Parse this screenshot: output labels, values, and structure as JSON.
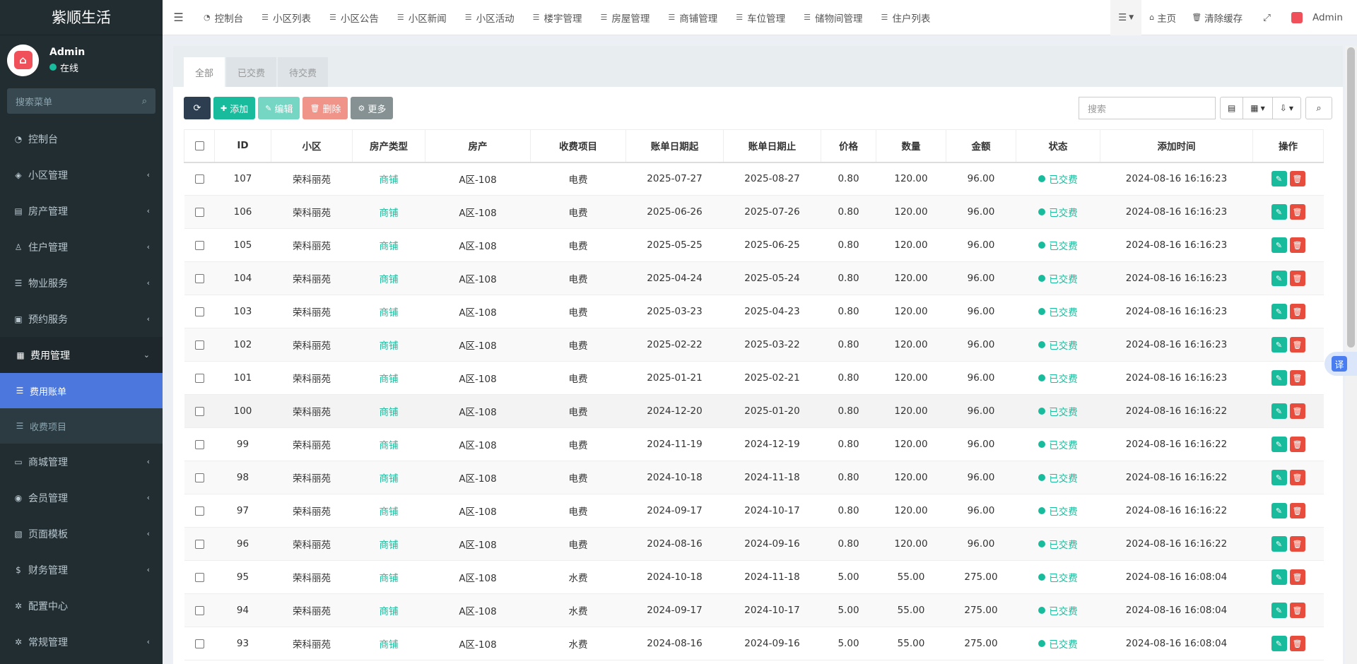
{
  "app": {
    "title": "紫顺生活"
  },
  "user": {
    "name": "Admin",
    "status": "在线"
  },
  "sidebar": {
    "search_placeholder": "搜索菜单",
    "items": [
      {
        "label": "控制台",
        "icon": "dashboard-icon",
        "glyph": "◔",
        "chev": ""
      },
      {
        "label": "小区管理",
        "icon": "cube-icon",
        "glyph": "◈",
        "chev": "‹"
      },
      {
        "label": "房产管理",
        "icon": "building-icon",
        "glyph": "▤",
        "chev": "‹"
      },
      {
        "label": "住户管理",
        "icon": "user-icon",
        "glyph": "♙",
        "chev": "‹"
      },
      {
        "label": "物业服务",
        "icon": "server-icon",
        "glyph": "☰",
        "chev": "‹"
      },
      {
        "label": "预约服务",
        "icon": "calendar-check-icon",
        "glyph": "▣",
        "chev": "‹"
      }
    ],
    "open_item": {
      "label": "费用管理",
      "icon": "calculator-icon",
      "glyph": "▦",
      "chev": "⌄"
    },
    "sub_items": [
      {
        "label": "费用账单",
        "active": true
      },
      {
        "label": "收费项目",
        "active": false
      }
    ],
    "items_after": [
      {
        "label": "商城管理",
        "icon": "shopping-basket-icon",
        "glyph": "▭",
        "chev": "‹"
      },
      {
        "label": "会员管理",
        "icon": "user-circle-icon",
        "glyph": "◉",
        "chev": "‹"
      },
      {
        "label": "页面模板",
        "icon": "image-icon",
        "glyph": "▧",
        "chev": "‹"
      },
      {
        "label": "财务管理",
        "icon": "dollar-icon",
        "glyph": "$",
        "chev": "‹"
      },
      {
        "label": "配置中心",
        "icon": "gear-icon",
        "glyph": "✲",
        "chev": ""
      },
      {
        "label": "常规管理",
        "icon": "cogs-icon",
        "glyph": "✲",
        "chev": "‹"
      }
    ]
  },
  "topnav": {
    "tabs": [
      "控制台",
      "小区列表",
      "小区公告",
      "小区新闻",
      "小区活动",
      "楼宇管理",
      "房屋管理",
      "商铺管理",
      "车位管理",
      "储物间管理",
      "住户列表"
    ],
    "home": "主页",
    "clear_cache": "清除缓存",
    "admin": "Admin"
  },
  "content_tabs": [
    "全部",
    "已交费",
    "待交费"
  ],
  "toolbar": {
    "add": "添加",
    "edit": "编辑",
    "delete": "删除",
    "more": "更多",
    "search_placeholder": "搜索"
  },
  "table": {
    "columns": [
      "ID",
      "小区",
      "房产类型",
      "房产",
      "收费项目",
      "账单日期起",
      "账单日期止",
      "价格",
      "数量",
      "金额",
      "状态",
      "添加时间",
      "操作"
    ],
    "rows": [
      [
        "107",
        "荣科丽苑",
        "商铺",
        "A区-108",
        "电费",
        "2025-07-27",
        "2025-08-27",
        "0.80",
        "120.00",
        "96.00",
        "已交费",
        "2024-08-16 16:16:23"
      ],
      [
        "106",
        "荣科丽苑",
        "商铺",
        "A区-108",
        "电费",
        "2025-06-26",
        "2025-07-26",
        "0.80",
        "120.00",
        "96.00",
        "已交费",
        "2024-08-16 16:16:23"
      ],
      [
        "105",
        "荣科丽苑",
        "商铺",
        "A区-108",
        "电费",
        "2025-05-25",
        "2025-06-25",
        "0.80",
        "120.00",
        "96.00",
        "已交费",
        "2024-08-16 16:16:23"
      ],
      [
        "104",
        "荣科丽苑",
        "商铺",
        "A区-108",
        "电费",
        "2025-04-24",
        "2025-05-24",
        "0.80",
        "120.00",
        "96.00",
        "已交费",
        "2024-08-16 16:16:23"
      ],
      [
        "103",
        "荣科丽苑",
        "商铺",
        "A区-108",
        "电费",
        "2025-03-23",
        "2025-04-23",
        "0.80",
        "120.00",
        "96.00",
        "已交费",
        "2024-08-16 16:16:23"
      ],
      [
        "102",
        "荣科丽苑",
        "商铺",
        "A区-108",
        "电费",
        "2025-02-22",
        "2025-03-22",
        "0.80",
        "120.00",
        "96.00",
        "已交费",
        "2024-08-16 16:16:23"
      ],
      [
        "101",
        "荣科丽苑",
        "商铺",
        "A区-108",
        "电费",
        "2025-01-21",
        "2025-02-21",
        "0.80",
        "120.00",
        "96.00",
        "已交费",
        "2024-08-16 16:16:23"
      ],
      [
        "100",
        "荣科丽苑",
        "商铺",
        "A区-108",
        "电费",
        "2024-12-20",
        "2025-01-20",
        "0.80",
        "120.00",
        "96.00",
        "已交费",
        "2024-08-16 16:16:22"
      ],
      [
        "99",
        "荣科丽苑",
        "商铺",
        "A区-108",
        "电费",
        "2024-11-19",
        "2024-12-19",
        "0.80",
        "120.00",
        "96.00",
        "已交费",
        "2024-08-16 16:16:22"
      ],
      [
        "98",
        "荣科丽苑",
        "商铺",
        "A区-108",
        "电费",
        "2024-10-18",
        "2024-11-18",
        "0.80",
        "120.00",
        "96.00",
        "已交费",
        "2024-08-16 16:16:22"
      ],
      [
        "97",
        "荣科丽苑",
        "商铺",
        "A区-108",
        "电费",
        "2024-09-17",
        "2024-10-17",
        "0.80",
        "120.00",
        "96.00",
        "已交费",
        "2024-08-16 16:16:22"
      ],
      [
        "96",
        "荣科丽苑",
        "商铺",
        "A区-108",
        "电费",
        "2024-08-16",
        "2024-09-16",
        "0.80",
        "120.00",
        "96.00",
        "已交费",
        "2024-08-16 16:16:22"
      ],
      [
        "95",
        "荣科丽苑",
        "商铺",
        "A区-108",
        "水费",
        "2024-10-18",
        "2024-11-18",
        "5.00",
        "55.00",
        "275.00",
        "已交费",
        "2024-08-16 16:08:04"
      ],
      [
        "94",
        "荣科丽苑",
        "商铺",
        "A区-108",
        "水费",
        "2024-09-17",
        "2024-10-17",
        "5.00",
        "55.00",
        "275.00",
        "已交费",
        "2024-08-16 16:08:04"
      ],
      [
        "93",
        "荣科丽苑",
        "商铺",
        "A区-108",
        "水费",
        "2024-08-16",
        "2024-09-16",
        "5.00",
        "55.00",
        "275.00",
        "已交费",
        "2024-08-16 16:08:04"
      ]
    ]
  },
  "translate_button": "译",
  "colors": {
    "sidebar": "#222d32",
    "accent": "#18bc9c",
    "danger": "#e74c3c",
    "active_sub": "#4c78dd"
  }
}
